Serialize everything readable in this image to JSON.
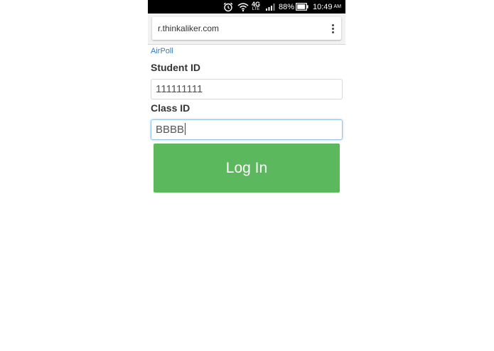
{
  "status_bar": {
    "network": "4G",
    "network_sub": "LTE",
    "battery": "88%",
    "time": "10:49",
    "ampm": "AM",
    "icons": [
      "alarm-icon",
      "wifi-icon",
      "signal-icon",
      "battery-icon"
    ]
  },
  "browser": {
    "url": "r.thinkaliker.com",
    "menu_icon": "overflow-menu-icon"
  },
  "page": {
    "brand": "AirPoll",
    "student_label": "Student ID",
    "student_value": "111111111",
    "class_label": "Class ID",
    "class_value": "BBBB",
    "login_label": "Log In",
    "login_color": "#5cb85c",
    "brand_color": "#3a7ab8"
  }
}
